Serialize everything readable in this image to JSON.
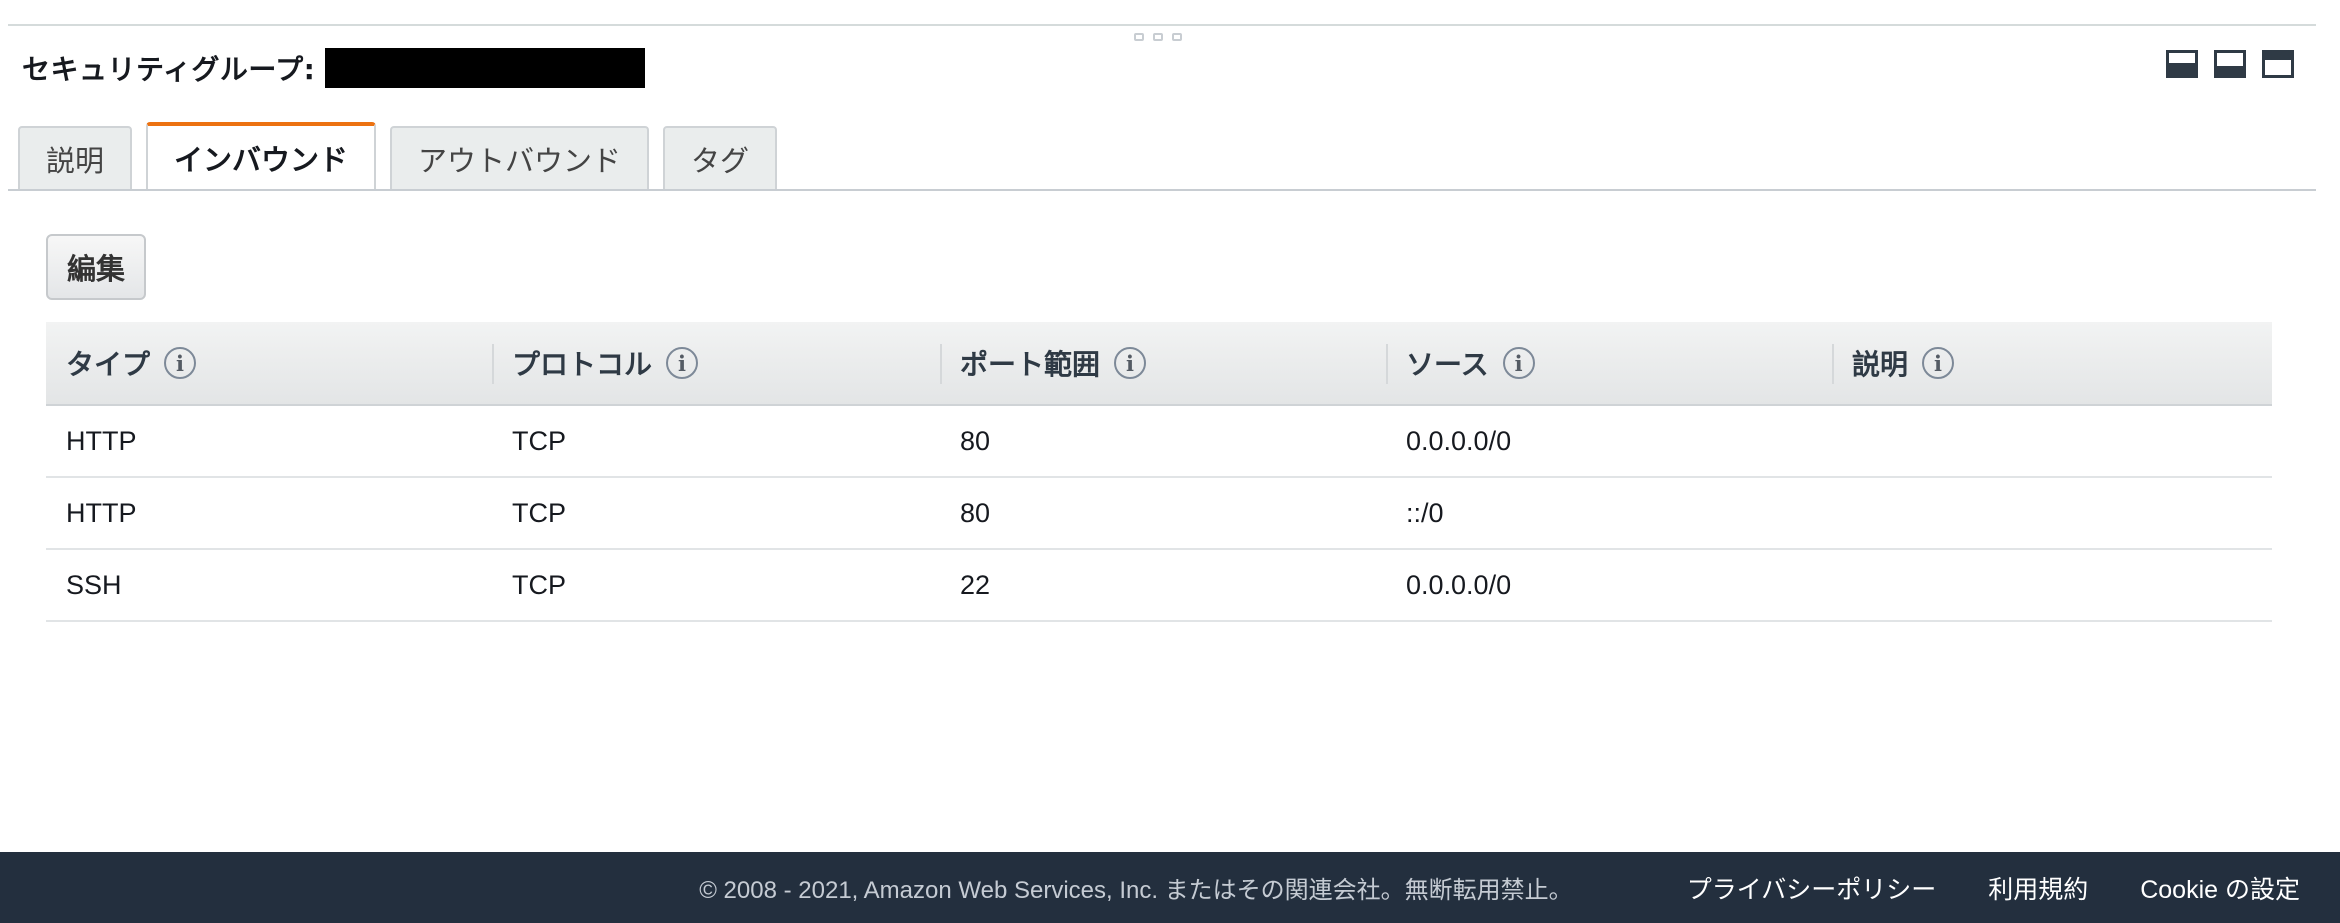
{
  "header": {
    "title": "セキュリティグループ:"
  },
  "tabs": [
    {
      "label": "説明",
      "active": false
    },
    {
      "label": "インバウンド",
      "active": true
    },
    {
      "label": "アウトバウンド",
      "active": false
    },
    {
      "label": "タグ",
      "active": false
    }
  ],
  "toolbar": {
    "edit_label": "編集"
  },
  "table": {
    "columns": [
      "タイプ",
      "プロトコル",
      "ポート範囲",
      "ソース",
      "説明"
    ],
    "rows": [
      {
        "type": "HTTP",
        "protocol": "TCP",
        "port": "80",
        "source": "0.0.0.0/0",
        "description": ""
      },
      {
        "type": "HTTP",
        "protocol": "TCP",
        "port": "80",
        "source": "::/0",
        "description": ""
      },
      {
        "type": "SSH",
        "protocol": "TCP",
        "port": "22",
        "source": "0.0.0.0/0",
        "description": ""
      }
    ]
  },
  "icons": {
    "info": "info-icon",
    "info_glyph": "i",
    "layout": [
      "panel-bottom-icon",
      "panel-half-icon",
      "panel-top-icon"
    ]
  },
  "footer": {
    "copyright": "© 2008 - 2021, Amazon Web Services, Inc. またはその関連会社。無断転用禁止。",
    "links": [
      "プライバシーポリシー",
      "利用規約",
      "Cookie の設定"
    ]
  },
  "colors": {
    "accent": "#ec7211",
    "footer_bg": "#232f3e"
  }
}
